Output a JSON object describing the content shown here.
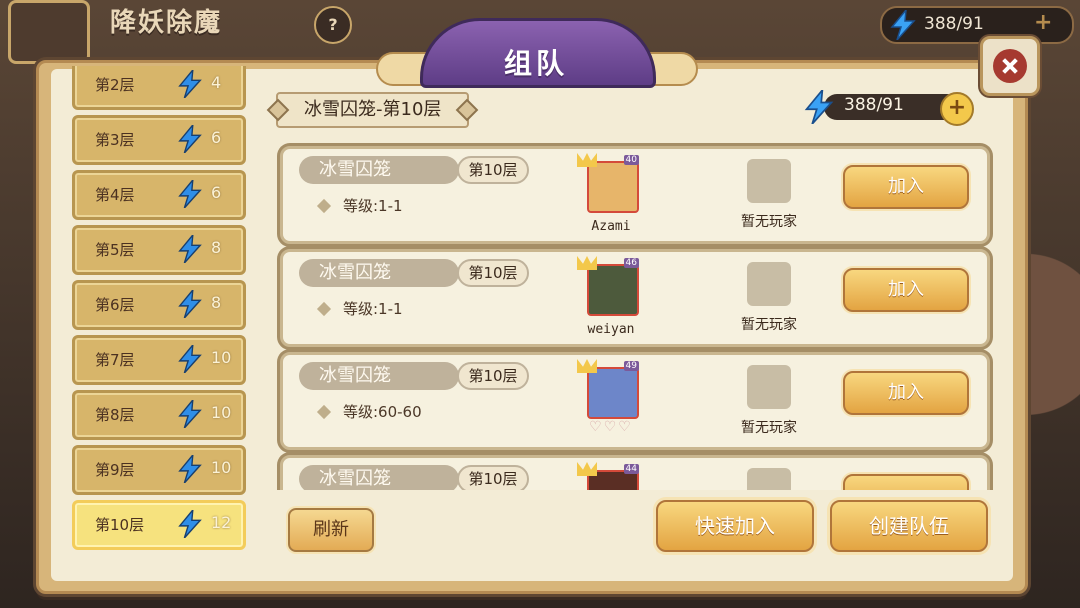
{
  "topbar": {
    "title": "降妖除魔",
    "help_label": "?",
    "energy": "388/91",
    "plus_label": "+"
  },
  "dialog": {
    "title": "组队"
  },
  "floors": [
    {
      "label": "第2层",
      "energy": "4",
      "selected": false
    },
    {
      "label": "第3层",
      "energy": "6",
      "selected": false
    },
    {
      "label": "第4层",
      "energy": "6",
      "selected": false
    },
    {
      "label": "第5层",
      "energy": "8",
      "selected": false
    },
    {
      "label": "第6层",
      "energy": "8",
      "selected": false
    },
    {
      "label": "第7层",
      "energy": "10",
      "selected": false
    },
    {
      "label": "第8层",
      "energy": "10",
      "selected": false
    },
    {
      "label": "第9层",
      "energy": "10",
      "selected": false
    },
    {
      "label": "第10层",
      "energy": "12",
      "selected": true
    }
  ],
  "header": {
    "dungeon_title": "冰雪囚笼-第10层",
    "energy": "388/91",
    "plus_label": "+"
  },
  "teams": [
    {
      "dungeon": "冰雪囚笼",
      "floor": "第10层",
      "level": "等级:1-1",
      "player": "Azami",
      "player_level": "40",
      "slot_text": "暂无玩家",
      "join": "加入",
      "avatar_color": "#e7b56a"
    },
    {
      "dungeon": "冰雪囚笼",
      "floor": "第10层",
      "level": "等级:1-1",
      "player": "weiyan",
      "player_level": "46",
      "slot_text": "暂无玩家",
      "join": "加入",
      "avatar_color": "#4d5a3c"
    },
    {
      "dungeon": "冰雪囚笼",
      "floor": "第10层",
      "level": "等级:60-60",
      "player": "",
      "hearts": "♡♡♡",
      "player_level": "49",
      "slot_text": "暂无玩家",
      "join": "加入",
      "avatar_color": "#6d86c9"
    },
    {
      "dungeon": "冰雪囚笼",
      "floor": "第10层",
      "level": "",
      "player": "",
      "player_level": "44",
      "slot_text": "",
      "join": "",
      "avatar_color": "#5a2e24"
    }
  ],
  "actions": {
    "refresh": "刷新",
    "quick_join": "快速加入",
    "create_team": "创建队伍"
  },
  "colors": {
    "panel": "#f3ecd6",
    "button": "#e3a442",
    "selected_floor": "#f6e27e"
  }
}
